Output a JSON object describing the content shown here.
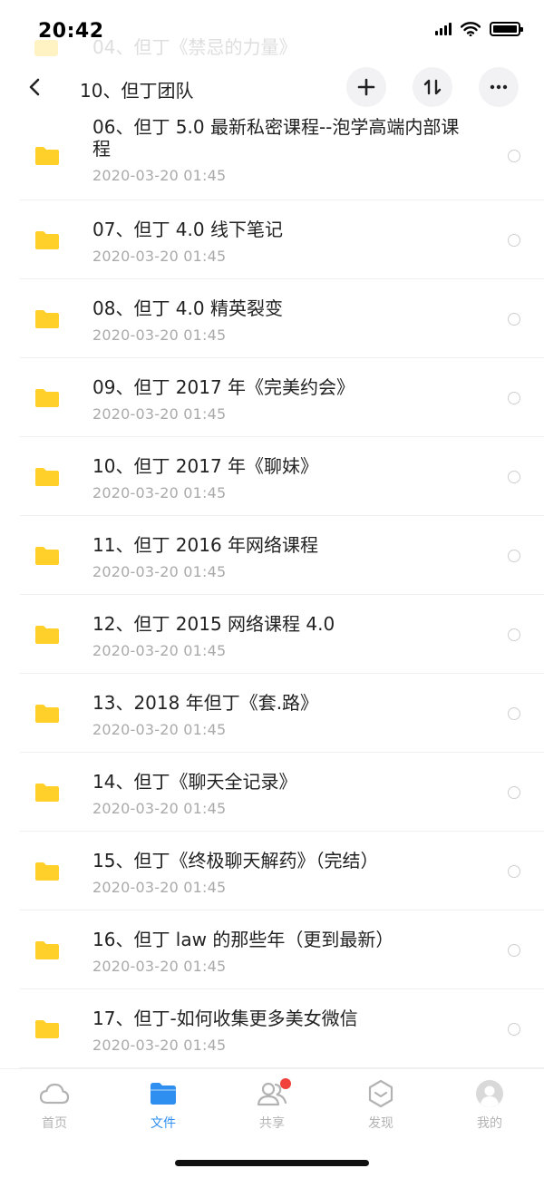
{
  "status_bar": {
    "time": "20:42"
  },
  "ghost_row": {
    "name": "04、但丁《禁忌的力量》"
  },
  "nav": {
    "title": "10、但丁团队"
  },
  "files": [
    {
      "name": "06、但丁 5.0 最新私密课程--泡学高端内部课程",
      "date": "2020-03-20 01:45"
    },
    {
      "name": "07、但丁 4.0 线下笔记",
      "date": "2020-03-20 01:45"
    },
    {
      "name": "08、但丁 4.0 精英裂变",
      "date": "2020-03-20 01:45"
    },
    {
      "name": "09、但丁 2017 年《完美约会》",
      "date": "2020-03-20 01:45"
    },
    {
      "name": "10、但丁 2017 年《聊妹》",
      "date": "2020-03-20 01:45"
    },
    {
      "name": "11、但丁 2016 年网络课程",
      "date": "2020-03-20 01:45"
    },
    {
      "name": "12、但丁 2015 网络课程 4.0",
      "date": "2020-03-20 01:45"
    },
    {
      "name": "13、2018 年但丁《套.路》",
      "date": "2020-03-20 01:45"
    },
    {
      "name": "14、但丁《聊天全记录》",
      "date": "2020-03-20 01:45"
    },
    {
      "name": "15、但丁《终极聊天解药》（完结）",
      "date": "2020-03-20 01:45"
    },
    {
      "name": "16、但丁 law 的那些年（更到最新）",
      "date": "2020-03-20 01:45"
    },
    {
      "name": "17、但丁-如何收集更多美女微信",
      "date": "2020-03-20 01:45"
    }
  ],
  "tabs": [
    {
      "label": "首页",
      "icon": "cloud-icon",
      "active": false
    },
    {
      "label": "文件",
      "icon": "folder-icon",
      "active": true
    },
    {
      "label": "共享",
      "icon": "people-icon",
      "active": false,
      "badge": true
    },
    {
      "label": "发现",
      "icon": "discover-icon",
      "active": false
    },
    {
      "label": "我的",
      "icon": "avatar-icon",
      "active": false
    }
  ],
  "colors": {
    "accent": "#2f8ff0",
    "folder": "#ffd02a",
    "badge": "#f0413a"
  }
}
